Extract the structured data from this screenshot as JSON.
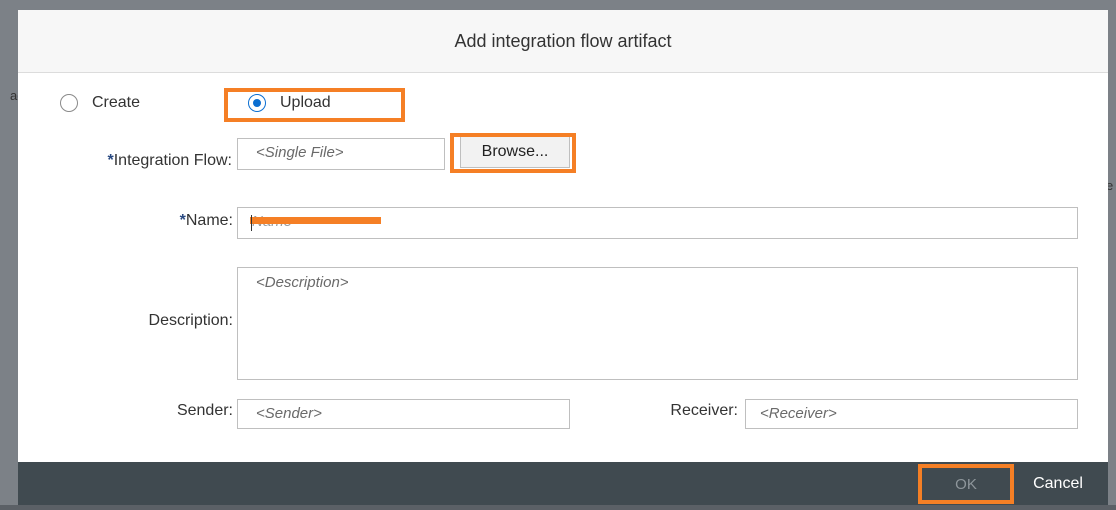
{
  "dialog": {
    "title": "Add integration flow artifact"
  },
  "mode": {
    "create_label": "Create",
    "upload_label": "Upload",
    "selected": "Upload"
  },
  "fields": {
    "integration_flow": {
      "required_mark": "*",
      "label": "Integration Flow:",
      "placeholder": "<Single File>",
      "browse_label": "Browse..."
    },
    "name": {
      "required_mark": "*",
      "label": "Name:",
      "placeholder": "Name"
    },
    "description": {
      "label": "Description:",
      "placeholder": "<Description>"
    },
    "sender": {
      "label": "Sender:",
      "placeholder": "<Sender>"
    },
    "receiver": {
      "label": "Receiver:",
      "placeholder": "<Receiver>"
    }
  },
  "footer": {
    "ok_label": "OK",
    "cancel_label": "Cancel"
  },
  "background": {
    "peek_left": "ag",
    "peek_right": "e"
  },
  "colors": {
    "highlight": "#f57f25",
    "footer_bg": "#404a50",
    "radio_accent": "#0a6ed1",
    "redaction": "#f57f25"
  }
}
